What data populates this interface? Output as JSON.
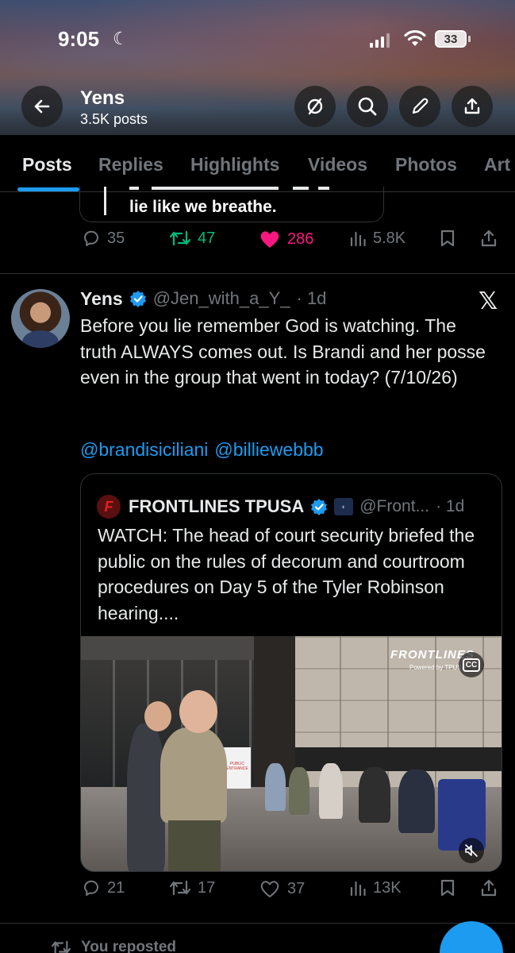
{
  "status_bar": {
    "time": "9:05",
    "battery": "33"
  },
  "profile_header": {
    "name": "Yens",
    "post_count": "3.5K posts"
  },
  "tabs": [
    {
      "label": "Posts",
      "active": true
    },
    {
      "label": "Replies"
    },
    {
      "label": "Highlights"
    },
    {
      "label": "Videos"
    },
    {
      "label": "Photos"
    },
    {
      "label": "Art"
    }
  ],
  "previous_post": {
    "quote_text": "lie like we breathe.",
    "replies": "35",
    "reposts": "47",
    "likes": "286",
    "views": "5.8K",
    "liked": true,
    "reposted": true
  },
  "post": {
    "author_name": "Yens",
    "handle": "@Jen_with_a_Y_",
    "time": "· 1d",
    "text": "Before you lie remember God is watching. The truth ALWAYS comes out. Is Brandi and her posse even in the group that went in today? (7/10/26)",
    "mentions": [
      "@brandisiciliani",
      "@billiewebbb"
    ],
    "quote": {
      "author_name": "FRONTLINES TPUSA",
      "handle": "@Front...",
      "time": "· 1d",
      "text": "WATCH: The head of court security briefed the public on the rules of decorum and courtroom procedures on Day 5 of the Tyler Robinson hearing....",
      "video_watermark": "FRONTLINES",
      "video_watermark_sub": "Powered by TPUSA",
      "cc_label": "CC",
      "sign_text": "PUBLIC ENTRANCE"
    },
    "replies": "21",
    "reposts": "17",
    "likes": "37",
    "views": "13K"
  },
  "next_post": {
    "social_context": "You reposted"
  },
  "colors": {
    "accent": "#1d9bf0",
    "like": "#f91880",
    "repost": "#00ba7c",
    "muted": "#71767b"
  }
}
